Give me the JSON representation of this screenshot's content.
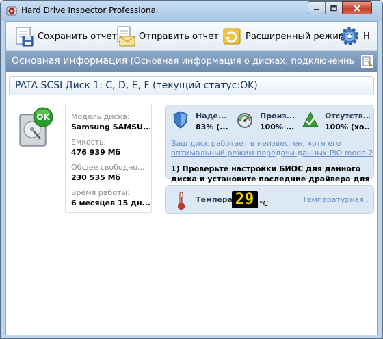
{
  "window": {
    "title": "Hard Drive Inspector Professional"
  },
  "toolbar": {
    "save_label": "Сохранить отчет",
    "send_label": "Отправить отчет",
    "advanced_label": "Расширенный режим",
    "settings_label": "Н"
  },
  "section": {
    "title": "Основная информация",
    "subtitle": "(Основная информация о дисках, подключенных к ком..."
  },
  "disk": {
    "title": "PATA SCSI Диск 1: C, D, E, F (текущий статус:OK)",
    "status_badge": "OK",
    "model_label": "Модель диска:",
    "model_value": "Samsung SAMSU...",
    "capacity_label": "Емкость:",
    "capacity_value": "476 939 Мб",
    "free_label": "Общее свободно...",
    "free_value": "230 535 Мб",
    "uptime_label": "Время работы:",
    "uptime_value": "6 месяцев 15 дн..."
  },
  "status": {
    "reliability_label": "Наде...",
    "reliability_value": "83% (...",
    "performance_label": "Произ...",
    "performance_value": "100% ...",
    "errors_label": "Отсутств...",
    "errors_value": "100% (хо...",
    "link_text": "Ваш диск работает в неизвестен, хотя его оптимальный режим передачи данных PIO mode 2",
    "advice_text": "1) Проверьте настройки БИОС для данного диска и установите последние драйвера для"
  },
  "temperature": {
    "label": "Температ...",
    "value": "29",
    "unit": "°C",
    "link": "Температурная..."
  },
  "colors": {
    "accent": "#6f8cb0",
    "status_ok": "#2f9b2f",
    "link": "#6a8fc4",
    "title_bar": "#a9c6e6"
  },
  "icons": [
    "app-icon",
    "minimize-icon",
    "maximize-icon",
    "close-icon",
    "save-report-icon",
    "send-report-icon",
    "advanced-mode-icon",
    "settings-gear-icon",
    "details-icon",
    "hard-drive-icon",
    "shield-icon",
    "speedometer-icon",
    "checkmark-icon",
    "thermometer-icon"
  ]
}
